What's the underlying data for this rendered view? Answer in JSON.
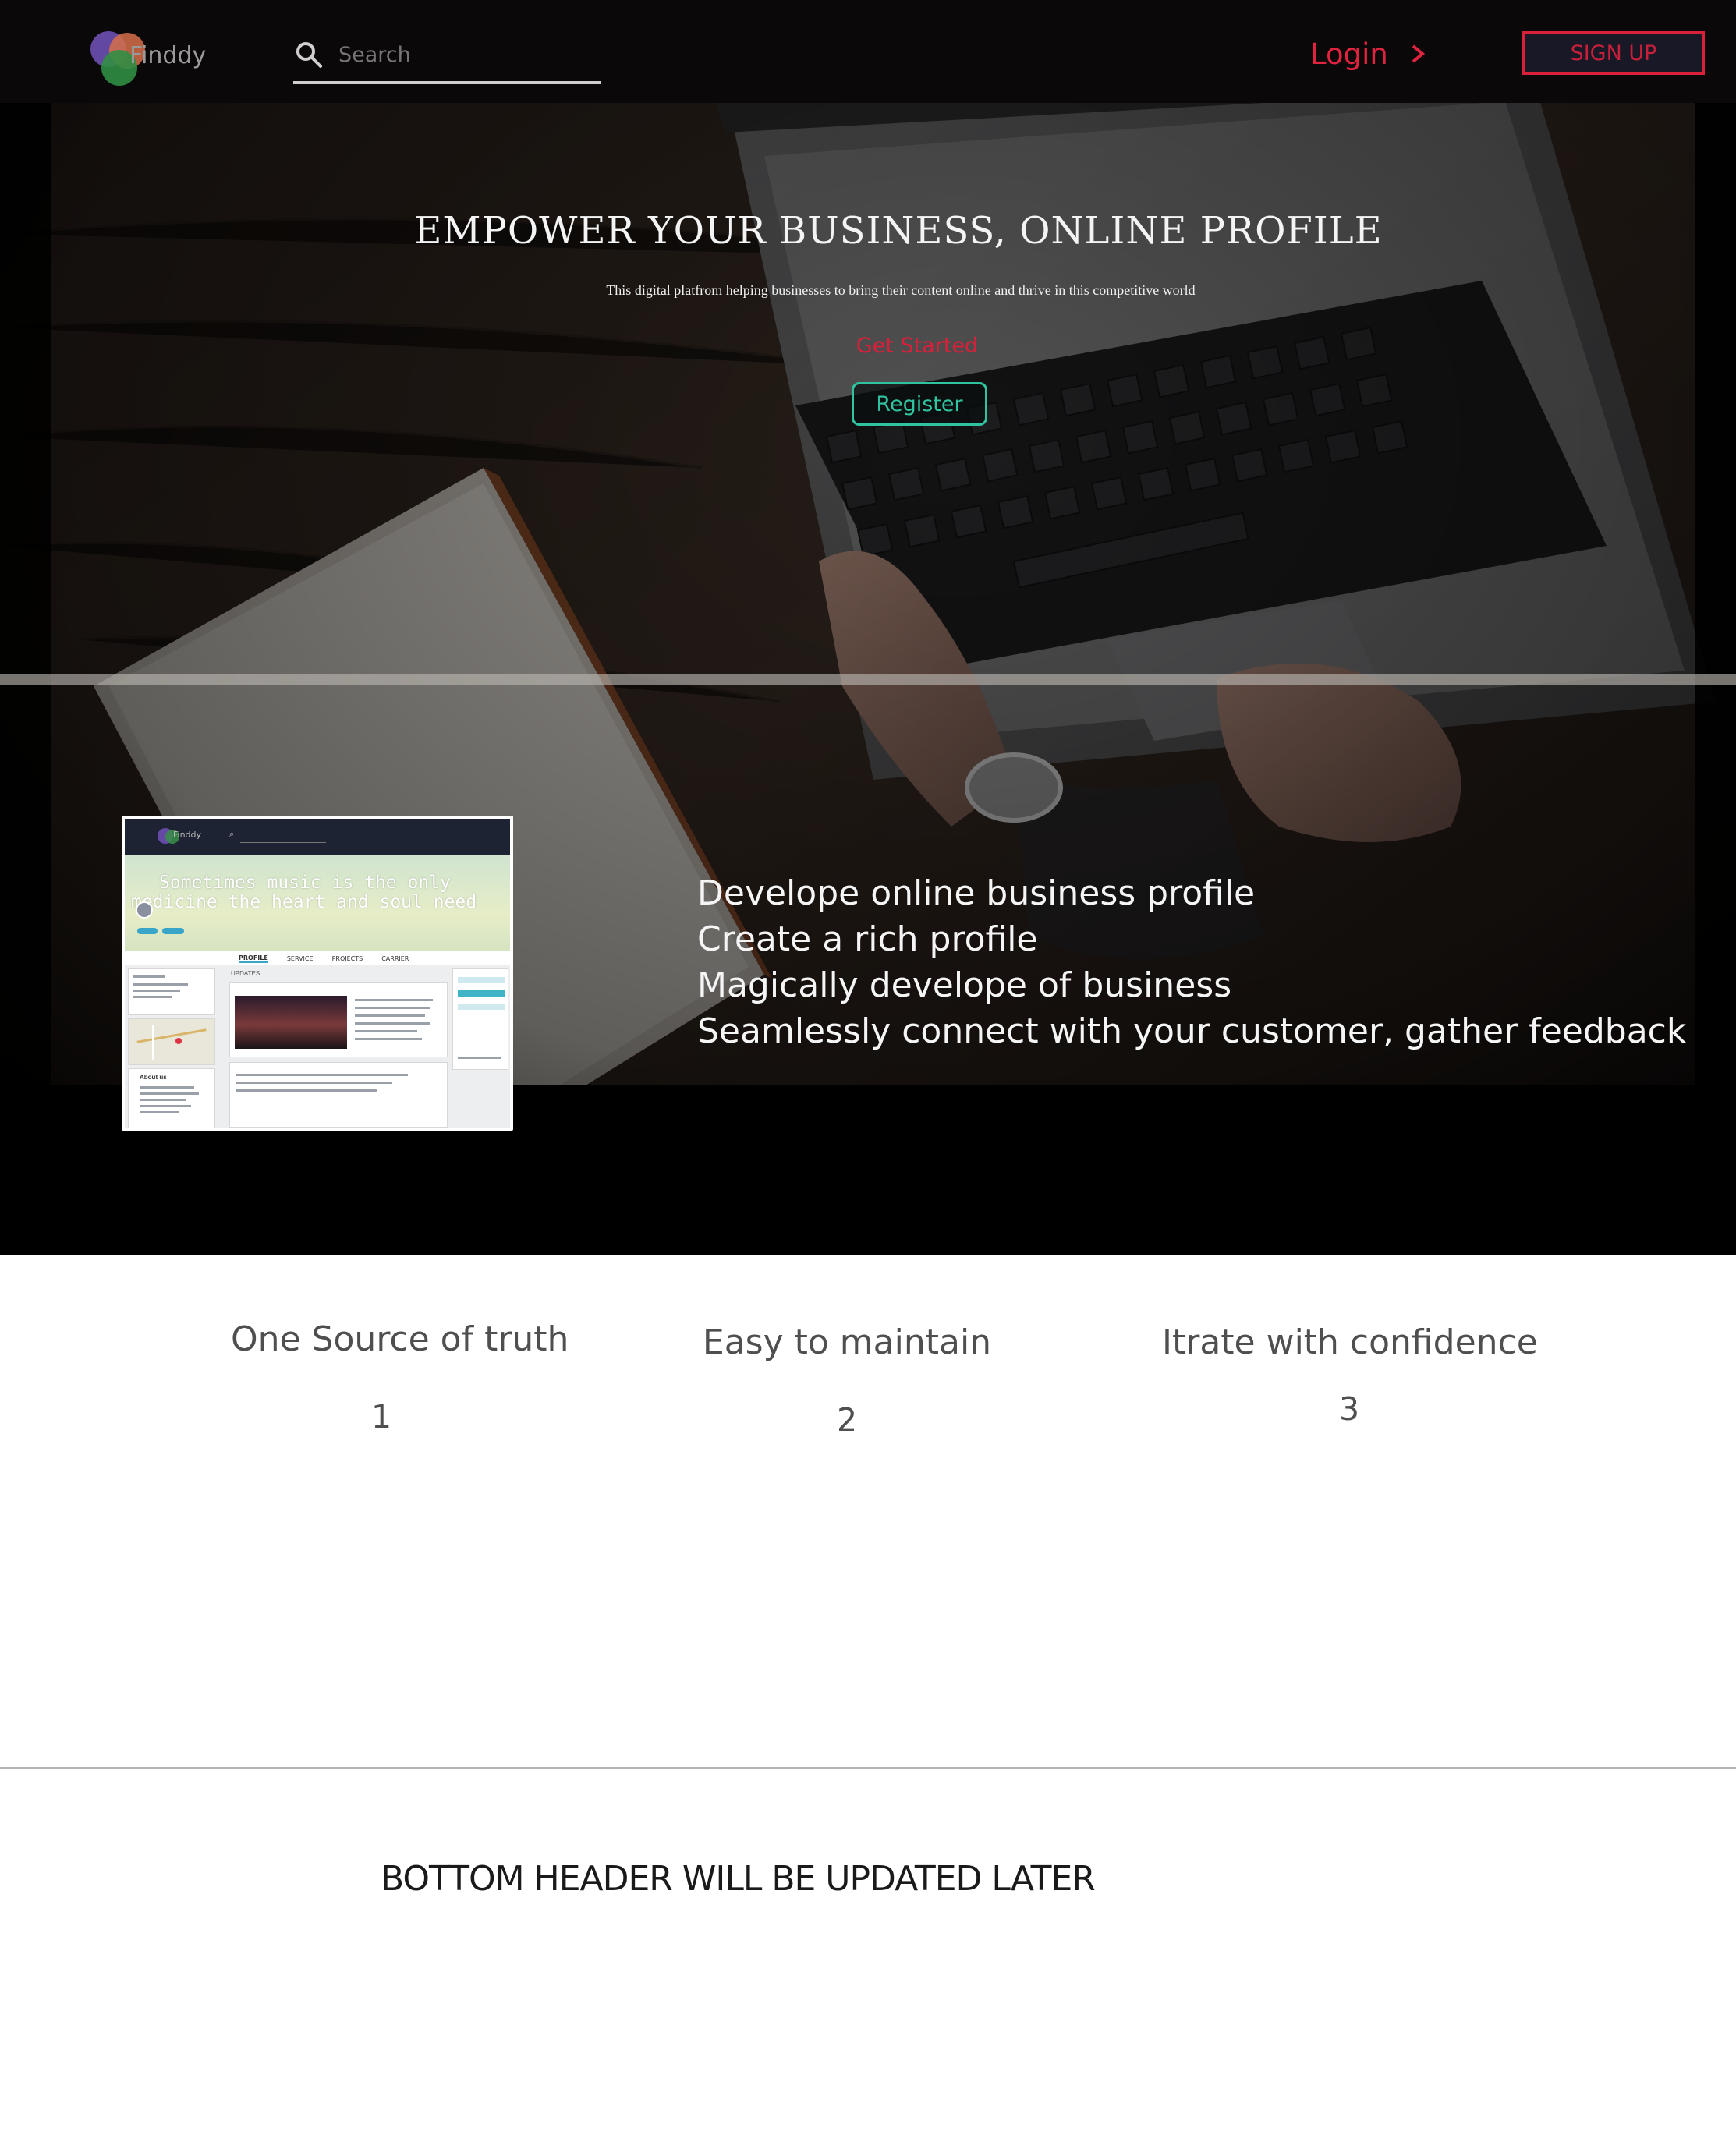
{
  "brand": {
    "name": "Finddy"
  },
  "nav": {
    "search_placeholder": "Search",
    "login_label": "Login",
    "signup_label": "SIGN UP"
  },
  "hero": {
    "title": "EMPOWER YOUR BUSINESS, ONLINE PROFILE",
    "subtitle": "This digital platfrom helping businesses to bring their content online and thrive in this competitive world",
    "get_started_label": "Get Started",
    "register_label": "Register"
  },
  "preview": {
    "logo_text": "Finddy",
    "quote_line1": "Sometimes music is the only",
    "quote_line2": "medicine the heart and soul need",
    "tabs": [
      "PROFILE",
      "SERVICE",
      "PROJECTS",
      "CARRIER"
    ],
    "updates_label": "UPDATES",
    "about_label": "About us"
  },
  "features": {
    "items": [
      "Develope online business profile",
      "Create a rich profile",
      "Magically develope of business",
      "Seamlessly connect with your customer, gather feedback"
    ]
  },
  "pillars": [
    {
      "title": "One Source of truth",
      "number": "1"
    },
    {
      "title": "Easy to maintain",
      "number": "2"
    },
    {
      "title": "Itrate with confidence",
      "number": "3"
    }
  ],
  "footer": {
    "text": "BOTTOM HEADER WILL BE UPDATED LATER"
  },
  "colors": {
    "nav_bg": "#0b080a",
    "accent_red": "#e0233f",
    "accent_teal": "#2fc3a0",
    "text_gray": "#4f4f4f"
  },
  "icons": {
    "search": "search-icon",
    "login_chevron": "chevron-right-icon",
    "brand": "logo-circles-icon"
  }
}
